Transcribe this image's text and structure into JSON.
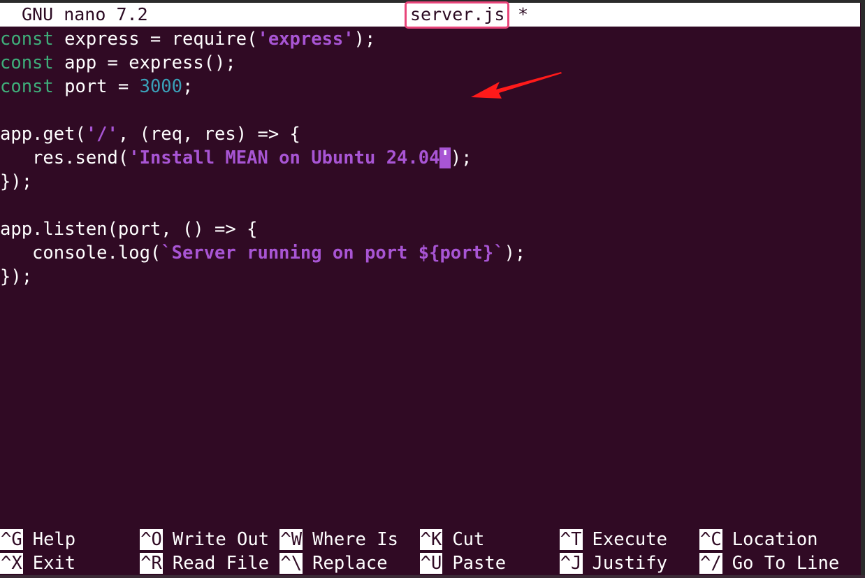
{
  "titlebar": {
    "app_version": "GNU nano 7.2",
    "filename": "server.js",
    "modified_marker": "*"
  },
  "editor": {
    "lines": [
      [
        {
          "t": "kw",
          "v": "const"
        },
        {
          "t": "p",
          "v": " express = require("
        },
        {
          "t": "s",
          "v": "'express'"
        },
        {
          "t": "p",
          "v": ");"
        }
      ],
      [
        {
          "t": "kw",
          "v": "const"
        },
        {
          "t": "p",
          "v": " app = express();"
        }
      ],
      [
        {
          "t": "kw",
          "v": "const"
        },
        {
          "t": "p",
          "v": " port = "
        },
        {
          "t": "n",
          "v": "3000"
        },
        {
          "t": "p",
          "v": ";"
        }
      ],
      [],
      [
        {
          "t": "p",
          "v": "app.get("
        },
        {
          "t": "s",
          "v": "'/'"
        },
        {
          "t": "p",
          "v": ", (req, res) => {"
        }
      ],
      [
        {
          "t": "p",
          "v": "   res.send("
        },
        {
          "t": "s",
          "v": "'Install MEAN on Ubuntu 24.04"
        },
        {
          "t": "c",
          "v": "'"
        },
        {
          "t": "p",
          "v": ");"
        }
      ],
      [
        {
          "t": "p",
          "v": "});"
        }
      ],
      [],
      [
        {
          "t": "p",
          "v": "app.listen(port, () => {"
        }
      ],
      [
        {
          "t": "p",
          "v": "   console.log("
        },
        {
          "t": "s",
          "v": "`Server running on port ${port}`"
        },
        {
          "t": "p",
          "v": ");"
        }
      ],
      [
        {
          "t": "p",
          "v": "});"
        }
      ]
    ]
  },
  "annotation": {
    "arrow_color": "#ff1a1a",
    "highlight_color": "#e8457a"
  },
  "shortcuts": {
    "row1": [
      {
        "key": "^G",
        "label": "Help"
      },
      {
        "key": "^O",
        "label": "Write Out"
      },
      {
        "key": "^W",
        "label": "Where Is"
      },
      {
        "key": "^K",
        "label": "Cut"
      },
      {
        "key": "^T",
        "label": "Execute"
      },
      {
        "key": "^C",
        "label": "Location"
      }
    ],
    "row2": [
      {
        "key": "^X",
        "label": "Exit"
      },
      {
        "key": "^R",
        "label": "Read File"
      },
      {
        "key": "^\\",
        "label": "Replace"
      },
      {
        "key": "^U",
        "label": "Paste"
      },
      {
        "key": "^J",
        "label": "Justify"
      },
      {
        "key": "^/",
        "label": "Go To Line"
      }
    ]
  },
  "colors": {
    "background": "#300a24",
    "keyword": "#3fae7a",
    "string": "#a855d4",
    "number": "#3aa0b8"
  }
}
